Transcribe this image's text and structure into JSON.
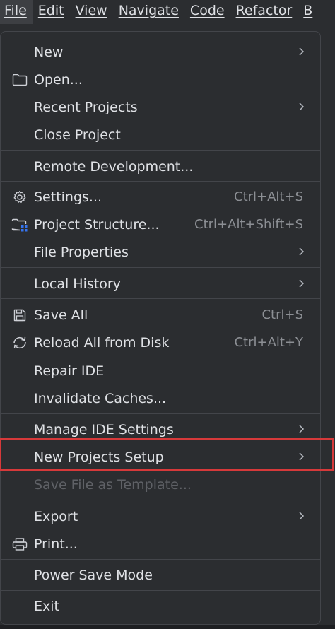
{
  "menubar": {
    "items": [
      "File",
      "Edit",
      "View",
      "Navigate",
      "Code",
      "Refactor",
      "B"
    ]
  },
  "file_menu": {
    "new": "New",
    "open": "Open...",
    "recent_projects": "Recent Projects",
    "close_project": "Close Project",
    "remote_development": "Remote Development...",
    "settings": "Settings...",
    "settings_shortcut": "Ctrl+Alt+S",
    "project_structure": "Project Structure...",
    "project_structure_shortcut": "Ctrl+Alt+Shift+S",
    "file_properties": "File Properties",
    "local_history": "Local History",
    "save_all": "Save All",
    "save_all_shortcut": "Ctrl+S",
    "reload_all": "Reload All from Disk",
    "reload_all_shortcut": "Ctrl+Alt+Y",
    "repair_ide": "Repair IDE",
    "invalidate_caches": "Invalidate Caches...",
    "manage_ide_settings": "Manage IDE Settings",
    "new_projects_setup": "New Projects Setup",
    "save_file_as_template": "Save File as Template...",
    "export": "Export",
    "print": "Print...",
    "power_save_mode": "Power Save Mode",
    "exit": "Exit"
  },
  "icons": {
    "open": "folder-icon",
    "settings": "gear-icon",
    "project_structure": "folder-grid-icon",
    "save_all": "floppy-disk-icon",
    "reload_all": "reload-icon",
    "print": "printer-icon",
    "submenu": "chevron-right-icon"
  },
  "colors": {
    "background": "#2b2d30",
    "text": "#dfe1e5",
    "shortcut": "#8c8f94",
    "disabled": "#5f6166",
    "highlight_border": "#d6393a",
    "accent_blue": "#3574f0"
  }
}
